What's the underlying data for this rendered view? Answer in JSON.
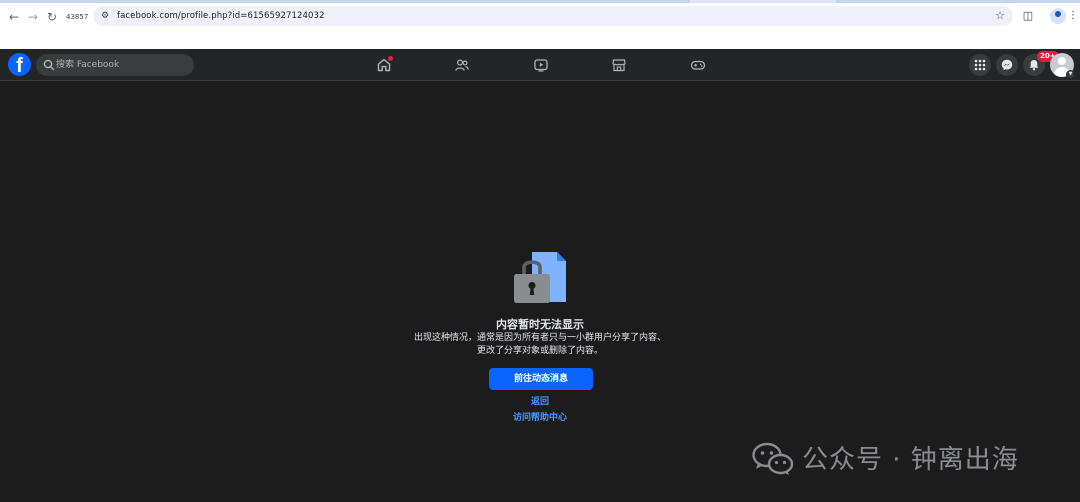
{
  "browser": {
    "tab_count": "43857",
    "url": "facebook.com/profile.php?id=61565927124032"
  },
  "fb": {
    "logo_letter": "f",
    "search_placeholder": "搜索 Facebook",
    "notification_badge": "20+",
    "accent": "#0866ff",
    "badge_color": "#e41e3f"
  },
  "content": {
    "title": "内容暂时无法显示",
    "description": "出现这种情况，通常是因为所有者只与一小群用户分享了内容、更改了分享对象或删除了内容。",
    "primary_button": "前往动态消息",
    "back_link": "返回",
    "help_link": "访问帮助中心",
    "link_color": "#4599ff"
  },
  "watermark": {
    "text": "公众号 · 钟离出海"
  }
}
